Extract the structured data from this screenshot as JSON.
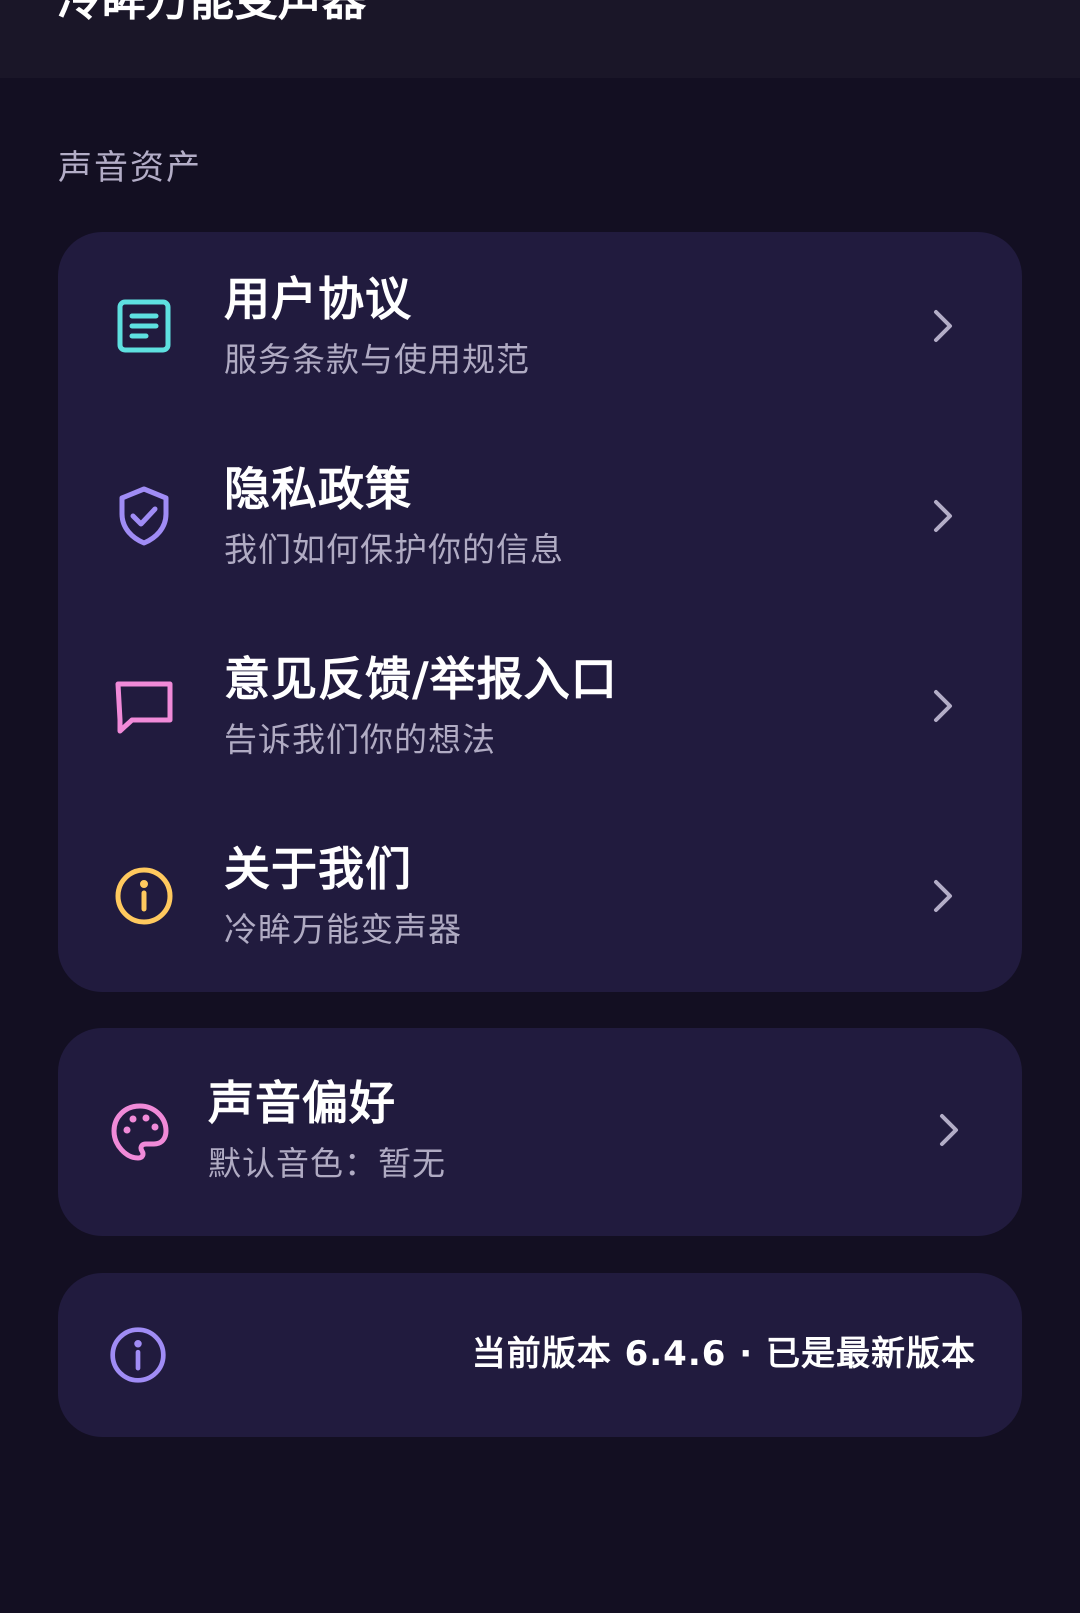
{
  "header": {
    "title": "冷眸万能变声器"
  },
  "section": {
    "title": "声音资产"
  },
  "menu": {
    "items": [
      {
        "title": "用户协议",
        "subtitle": "服务条款与使用规范",
        "icon": "document-icon",
        "color": "#5ee0e0"
      },
      {
        "title": "隐私政策",
        "subtitle": "我们如何保护你的信息",
        "icon": "shield-check-icon",
        "color": "#a08cf5"
      },
      {
        "title": "意见反馈/举报入口",
        "subtitle": "告诉我们你的想法",
        "icon": "message-icon",
        "color": "#f08ad8"
      },
      {
        "title": "关于我们",
        "subtitle": "冷眸万能变声器",
        "icon": "info-icon",
        "color": "#ffc95e"
      }
    ]
  },
  "preference": {
    "title": "声音偏好",
    "subtitle": "默认音色：暂无",
    "icon": "palette-icon",
    "color": "#f08ad8"
  },
  "version": {
    "text": "当前版本 6.4.6 · 已是最新版本",
    "icon": "info-icon",
    "color": "#a08cf5"
  }
}
